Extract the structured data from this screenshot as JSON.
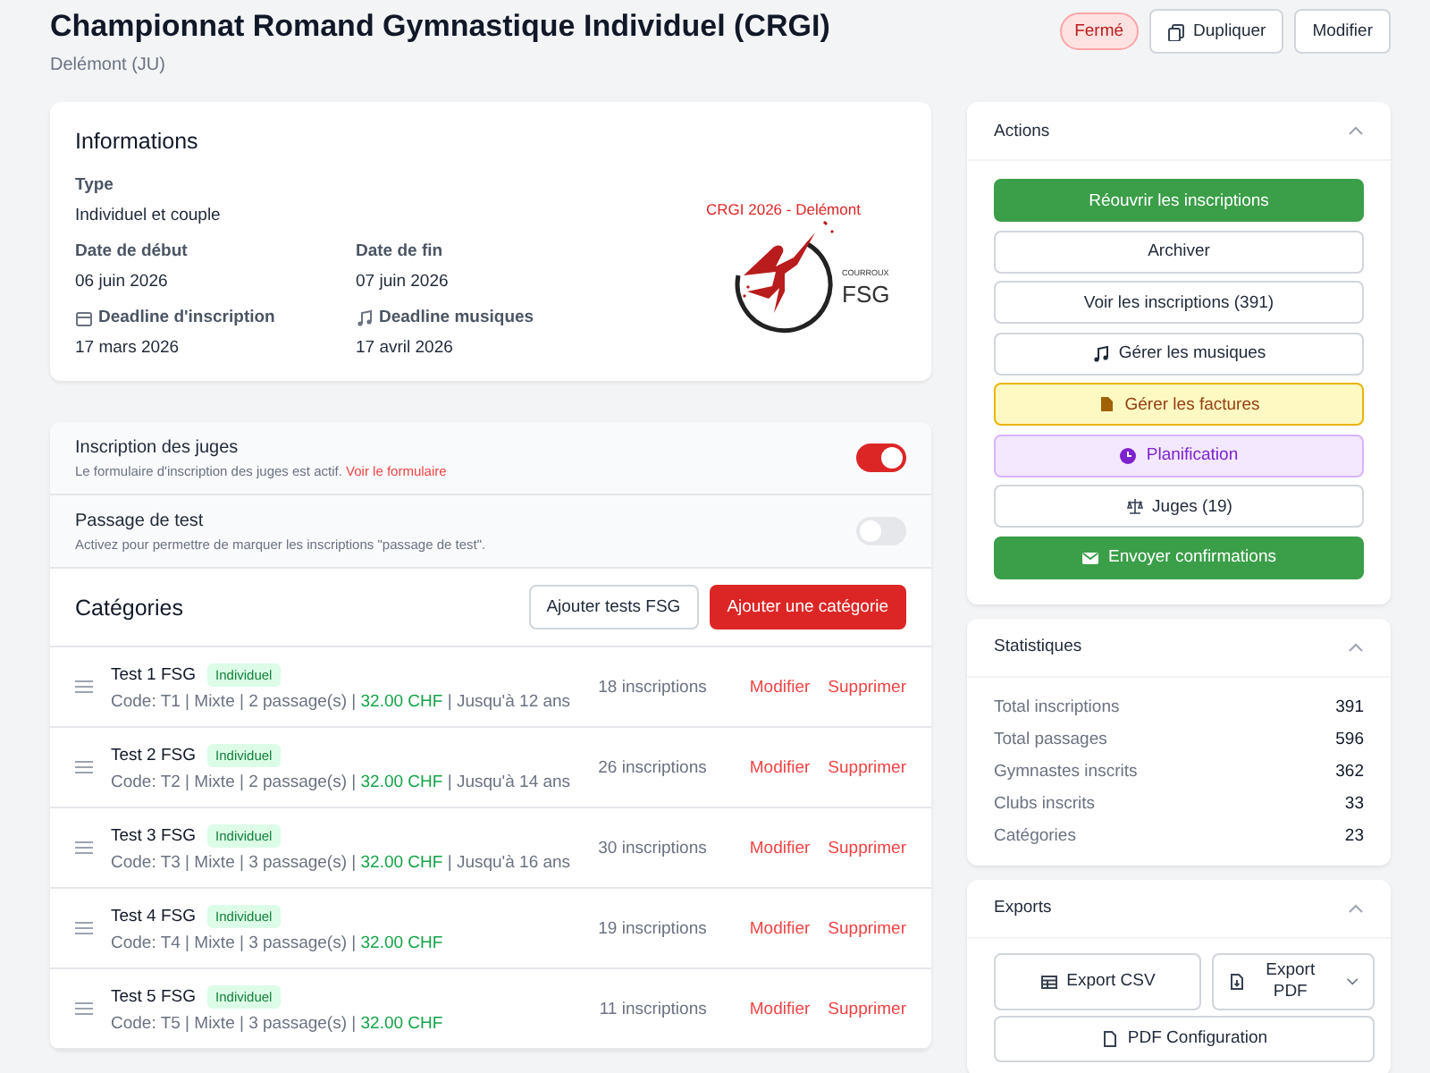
{
  "header": {
    "title": "Championnat Romand Gymnastique Individuel (CRGI)",
    "subtitle": "Delémont (JU)",
    "status": {
      "label": "Fermé",
      "kind": "closed"
    },
    "buttons": [
      {
        "label": "Dupliquer"
      },
      {
        "label": "Modifier"
      }
    ]
  },
  "info": {
    "title": "Informations",
    "rows": [
      [
        {
          "label": "Type",
          "value": "Individuel et couple"
        }
      ],
      [
        {
          "label": "Date de début",
          "value": "06 juin 2026"
        },
        {
          "label": "Date de fin",
          "value": "07 juin 2026"
        }
      ],
      [
        {
          "label": "Deadline d'inscription",
          "value": "17 mars 2026"
        },
        {
          "label": "Deadline musiques",
          "value": "17 avril 2026"
        }
      ]
    ],
    "logo": {
      "arc_text": "CRGI 2026 - Delémont",
      "club": "COURROUX",
      "federation": "FSG"
    }
  },
  "settings": [
    {
      "title": "Inscription des juges",
      "description": "Le formulaire d'inscription des juges est actif.",
      "link": "Voir le formulaire",
      "on": true
    },
    {
      "title": "Passage de test",
      "description": "Activez pour permettre de marquer les inscriptions \"passage de test\".",
      "on": false
    }
  ],
  "categories": {
    "title": "Catégories",
    "buttons": [
      {
        "label": "Ajouter tests FSG",
        "kind": "secondary"
      },
      {
        "label": "Ajouter une catégorie",
        "kind": "primary"
      }
    ],
    "items": [
      {
        "name": "Test 1 FSG",
        "badge": "Individuel",
        "details": "Code: T1 | Mixte | 2 passage(s) | ",
        "price": "32.00 CHF",
        "suffix": " | Jusqu'à 12 ans",
        "count": "18 inscriptions",
        "actions": [
          "Modifier",
          "Supprimer"
        ]
      },
      {
        "name": "Test 2 FSG",
        "badge": "Individuel",
        "details": "Code: T2 | Mixte | 2 passage(s) | ",
        "price": "32.00 CHF",
        "suffix": " | Jusqu'à 14 ans",
        "count": "26 inscriptions",
        "actions": [
          "Modifier",
          "Supprimer"
        ]
      },
      {
        "name": "Test 3 FSG",
        "badge": "Individuel",
        "details": "Code: T3 | Mixte | 3 passage(s) | ",
        "price": "32.00 CHF",
        "suffix": " | Jusqu'à 16 ans",
        "count": "30 inscriptions",
        "actions": [
          "Modifier",
          "Supprimer"
        ]
      },
      {
        "name": "Test 4 FSG",
        "badge": "Individuel",
        "details": "Code: T4 | Mixte | 3 passage(s) | ",
        "price": "32.00 CHF",
        "count": "19 inscriptions",
        "actions": [
          "Modifier",
          "Supprimer"
        ]
      },
      {
        "name": "Test 5 FSG",
        "badge": "Individuel",
        "details": "Code: T5 | Mixte | 3 passage(s) | ",
        "price": "32.00 CHF",
        "count": "11 inscriptions",
        "actions": [
          "Modifier",
          "Supprimer"
        ]
      }
    ]
  },
  "actions": {
    "title": "Actions",
    "expanded": true,
    "buttons": [
      {
        "label": "Réouvrir les inscriptions",
        "kind": "success"
      },
      {
        "label": "Archiver",
        "kind": "outline"
      },
      {
        "label": "Voir les inscriptions (391)",
        "kind": "outline"
      },
      {
        "label": "Gérer les musiques",
        "kind": "outline"
      },
      {
        "label": "Gérer les factures",
        "kind": "warning"
      },
      {
        "label": "Planification",
        "kind": "purple"
      },
      {
        "label": "Juges (19)",
        "kind": "outline"
      },
      {
        "label": "Envoyer confirmations",
        "kind": "success"
      }
    ]
  },
  "statistics": {
    "title": "Statistiques",
    "expanded": true,
    "rows": [
      {
        "label": "Total inscriptions",
        "value": "391"
      },
      {
        "label": "Total passages",
        "value": "596"
      },
      {
        "label": "Gymnastes inscrits",
        "value": "362"
      },
      {
        "label": "Clubs inscrits",
        "value": "33"
      },
      {
        "label": "Catégories",
        "value": "23"
      }
    ]
  },
  "exports": {
    "title": "Exports",
    "expanded": true,
    "buttons": [
      {
        "label": "Export CSV"
      },
      {
        "label": "Export PDF"
      },
      {
        "label": "PDF Configuration"
      }
    ]
  }
}
